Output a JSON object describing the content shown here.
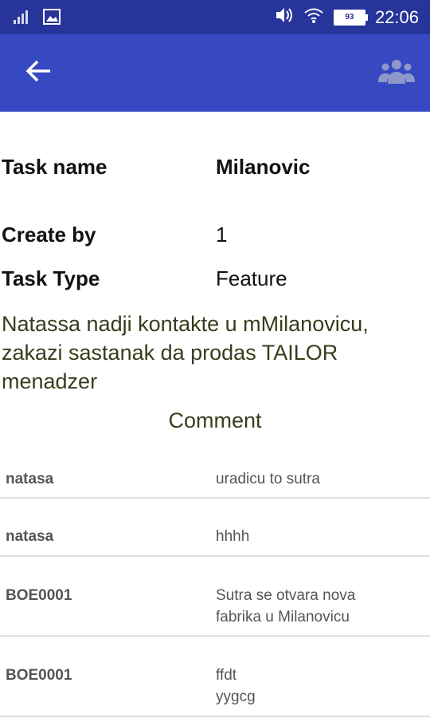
{
  "status_bar": {
    "time": "22:06",
    "battery": "93",
    "icons": [
      "signal-icon",
      "image-icon",
      "volume-icon",
      "wifi-icon",
      "battery-icon"
    ],
    "color": "#27349a"
  },
  "app_bar": {
    "back_icon": "arrow-left-icon",
    "group_icon": "group-icon",
    "color": "#3649c2"
  },
  "details": {
    "task_name_label": "Task name",
    "task_name_value": "Milanovic",
    "created_by_label": "Create by",
    "created_by_value": "1",
    "task_type_label": "Task Type",
    "task_type_value": "Feature"
  },
  "description": "Natassa nadji kontakte u mMilanovicu, zakazi sastanak da prodas TAILOR menadzer",
  "comments": {
    "title": "Comment",
    "items": [
      {
        "author": "natasa",
        "text": "uradicu to sutra"
      },
      {
        "author": "natasa",
        "text": "hhhh"
      },
      {
        "author": "BOE0001",
        "text": "Sutra se otvara nova\nfabrika u Milanovicu"
      },
      {
        "author": "BOE0001",
        "text": "ffdt\nyygcg"
      }
    ]
  }
}
